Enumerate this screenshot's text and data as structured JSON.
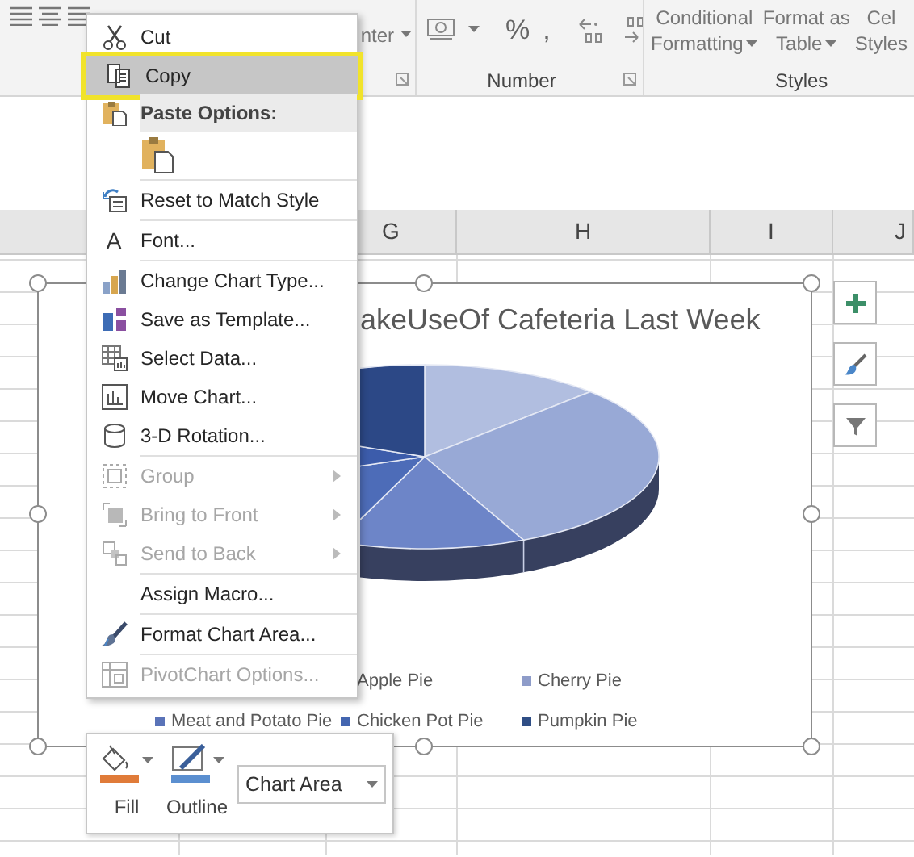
{
  "ribbon": {
    "alignment_fragment": "nter",
    "number_symbols": [
      "%",
      ","
    ],
    "number_group": "Number",
    "styles_buttons": [
      {
        "lines": [
          "Conditional",
          "Formatting"
        ],
        "dropdown": true
      },
      {
        "lines": [
          "Format as",
          "Table"
        ],
        "dropdown": true
      },
      {
        "lines": [
          "Cel",
          "Styles"
        ],
        "dropdown": false
      }
    ],
    "styles_group": "Styles"
  },
  "column_headers": [
    "G",
    "H",
    "I",
    "J"
  ],
  "chart": {
    "title": "akeUseOf Cafeteria Last Week",
    "legend": [
      [
        {
          "label": "Apple Pie"
        },
        {
          "label": "Cherry Pie",
          "color": "#8e9cc9"
        }
      ],
      [
        {
          "label": "Meat and Potato Pie",
          "color": "#5a73b8"
        },
        {
          "label": "Chicken Pot Pie",
          "color": "#4466b0"
        },
        {
          "label": "Pumpkin Pie",
          "color": "#2f4e85"
        }
      ]
    ]
  },
  "context_menu": [
    {
      "kind": "item",
      "label": "Cut",
      "selected": false,
      "disabled": false,
      "submenu": false,
      "separator_before": false
    },
    {
      "kind": "item",
      "label": "Copy",
      "selected": true,
      "disabled": false,
      "submenu": false,
      "separator_before": false
    },
    {
      "kind": "header",
      "label": "Paste Options:",
      "separator_before": false
    },
    {
      "kind": "paste-options",
      "separator_before": false
    },
    {
      "kind": "item",
      "label": "Reset to Match Style",
      "selected": false,
      "disabled": false,
      "submenu": false,
      "separator_before": true
    },
    {
      "kind": "item",
      "icon_char": "A",
      "label": "Font...",
      "selected": false,
      "disabled": false,
      "submenu": false,
      "separator_before": true
    },
    {
      "kind": "item",
      "label": "Change Chart Type...",
      "selected": false,
      "disabled": false,
      "submenu": false,
      "separator_before": true
    },
    {
      "kind": "item",
      "label": "Save as Template...",
      "selected": false,
      "disabled": false,
      "submenu": false,
      "separator_before": false
    },
    {
      "kind": "item",
      "label": "Select Data...",
      "selected": false,
      "disabled": false,
      "submenu": false,
      "separator_before": false
    },
    {
      "kind": "item",
      "label": "Move Chart...",
      "selected": false,
      "disabled": false,
      "submenu": false,
      "separator_before": false
    },
    {
      "kind": "item",
      "label": "3-D Rotation...",
      "selected": false,
      "disabled": false,
      "submenu": false,
      "separator_before": false
    },
    {
      "kind": "item",
      "label": "Group",
      "selected": false,
      "disabled": true,
      "submenu": true,
      "separator_before": true
    },
    {
      "kind": "item",
      "label": "Bring to Front",
      "selected": false,
      "disabled": true,
      "submenu": true,
      "separator_before": false
    },
    {
      "kind": "item",
      "label": "Send to Back",
      "selected": false,
      "disabled": true,
      "submenu": true,
      "separator_before": false
    },
    {
      "kind": "item",
      "label": "Assign Macro...",
      "selected": false,
      "disabled": false,
      "submenu": false,
      "separator_before": true
    },
    {
      "kind": "item",
      "label": "Format Chart Area...",
      "selected": false,
      "disabled": false,
      "submenu": false,
      "separator_before": true
    },
    {
      "kind": "item",
      "label": "PivotChart Options...",
      "selected": false,
      "disabled": true,
      "submenu": false,
      "separator_before": true
    }
  ],
  "mini_toolbar": {
    "buttons": [
      {
        "label": "Fill",
        "dropdown": true
      },
      {
        "label": "Outline",
        "dropdown": true
      }
    ],
    "element_picker": {
      "value": "Chart Area"
    }
  }
}
